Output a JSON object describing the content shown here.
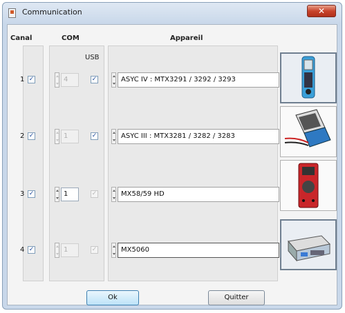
{
  "window": {
    "title": "Communication",
    "close_glyph": "✕"
  },
  "headers": {
    "canal": "Canal",
    "com": "COM",
    "usb": "USB",
    "appareil": "Appareil"
  },
  "rows": [
    {
      "canal": "1",
      "canal_checked": "✓",
      "com": "4",
      "com_enabled": false,
      "usb_checked": "✓",
      "usb_enabled": true,
      "device": "ASYC IV : MTX3291 / 3292 / 3293",
      "image": "handheld-multimeter-icon"
    },
    {
      "canal": "2",
      "canal_checked": "✓",
      "com": "1",
      "com_enabled": false,
      "usb_checked": "✓",
      "usb_enabled": true,
      "device": "ASYC III : MTX3281 / 3282 / 3283",
      "image": "multimeter-case-icon"
    },
    {
      "canal": "3",
      "canal_checked": "✓",
      "com": "1",
      "com_enabled": true,
      "usb_checked": "✓",
      "usb_enabled": false,
      "device": "MX58/59 HD",
      "image": "red-multimeter-icon"
    },
    {
      "canal": "4",
      "canal_checked": "✓",
      "com": "1",
      "com_enabled": false,
      "usb_checked": "✓",
      "usb_enabled": false,
      "device": "MX5060",
      "image": "bench-instrument-icon"
    }
  ],
  "buttons": {
    "ok": "Ok",
    "quit": "Quitter"
  },
  "colors": {
    "close": "#c8442c",
    "frame": "#c9d8ea",
    "default_button": "#bde3f8"
  }
}
